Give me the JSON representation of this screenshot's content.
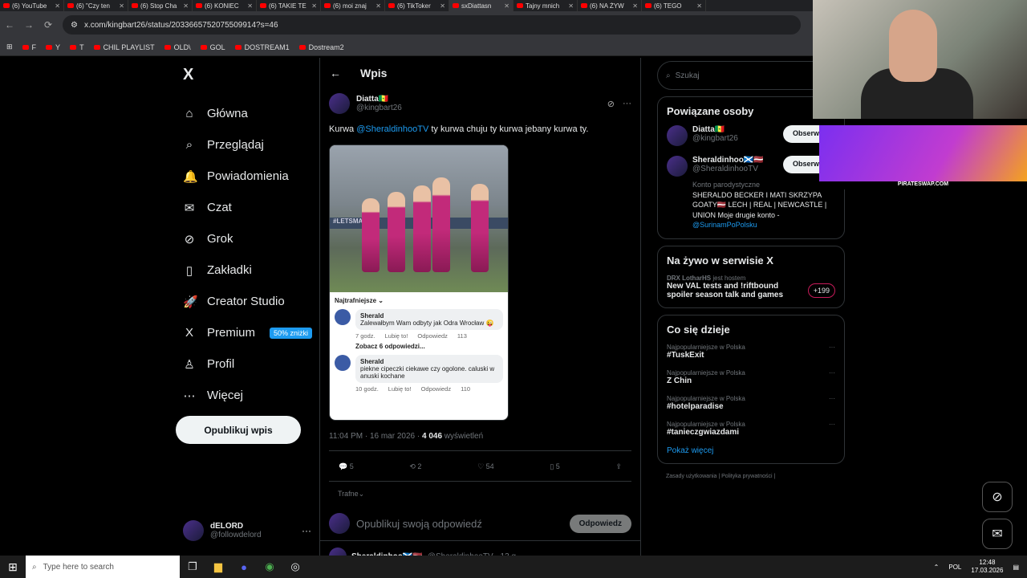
{
  "browser": {
    "tabs": [
      "(6) YouTube",
      "(6) \"Czy ten",
      "(6) Stop Cha",
      "(6) KONIEC",
      "(6) TAKIE TE",
      "(6) moi znaj",
      "(6) TikToker",
      "sxDiattasn",
      "Tajny mnich",
      "(6) NA ŻYW",
      "(6) TEGO"
    ],
    "url": "x.com/kingbart26/status/2033665752075509914?s=46",
    "bookmarks": [
      "F",
      "Y",
      "T",
      "CHIL PLAYLIST",
      "OLD\\",
      "GOL",
      "DOSTREAM1",
      "Dostream2"
    ]
  },
  "sidebar": {
    "logo": "X",
    "items": [
      {
        "label": "Główna",
        "icon": "⌂"
      },
      {
        "label": "Przeglądaj",
        "icon": "⌕"
      },
      {
        "label": "Powiadomienia",
        "icon": "🔔"
      },
      {
        "label": "Czat",
        "icon": "✉"
      },
      {
        "label": "Grok",
        "icon": "⊘"
      },
      {
        "label": "Zakładki",
        "icon": "▯"
      },
      {
        "label": "Creator Studio",
        "icon": "🚀"
      },
      {
        "label": "Premium",
        "icon": "X",
        "badge": "50% zniżki"
      },
      {
        "label": "Profil",
        "icon": "♙"
      },
      {
        "label": "Więcej",
        "icon": "⋯"
      }
    ],
    "post_button": "Opublikuj wpis",
    "account": {
      "name": "dELORD",
      "handle": "@followdelord",
      "more": "···"
    }
  },
  "main": {
    "back": "←",
    "title": "Wpis",
    "author": {
      "name": "Diatta🇸🇳",
      "handle": "@kingbart26"
    },
    "text_prefix": "Kurwa ",
    "mention": "@SheraldinhooTV",
    "text_suffix": " ty kurwa chuju ty kurwa jebany kurwa ty.",
    "media": {
      "banner": "#LETSMAKE",
      "sort": "Najtrafniejsze ⌄",
      "comments": [
        {
          "name": "Sherald",
          "text": "Zalewałbym Wam odbyty jak Odra Wrocław 😜",
          "time": "7 godz.",
          "like": "Lubię to!",
          "reply": "Odpowiedz",
          "count": "113"
        },
        {
          "name": "Sherald",
          "text": "piekne cipeczki ciekawe czy ogolone. caluski w anuski kochane",
          "time": "10 godz.",
          "like": "Lubię to!",
          "reply": "Odpowiedz",
          "count": "110"
        }
      ],
      "see_replies": "Zobacz 6 odpowiedzi..."
    },
    "meta_time": "11:04 PM · 16 mar 2026 · ",
    "views": "4 046",
    "views_label": " wyświetleń",
    "actions": {
      "replies": "5",
      "reposts": "2",
      "likes": "54",
      "bookmarks": "5"
    },
    "sort_label": "Trafne⌄",
    "reply_placeholder": "Opublikuj swoją odpowiedź",
    "reply_button": "Odpowiedz",
    "next_reply": {
      "name": "Sheraldinhoo🏴󠁧󠁢󠁳󠁣󠁴󠁿🇱🇻",
      "handle": "@SheraldinhooTV · 13 g."
    }
  },
  "right": {
    "search_placeholder": "Szukaj",
    "related_title": "Powiązane osoby",
    "people": [
      {
        "name": "Diatta🇸🇳",
        "handle": "@kingbart26",
        "follow": "Obserwuj"
      },
      {
        "name": "Sheraldinhoo🏴󠁧󠁢󠁳󠁣󠁴󠁿🇱🇻",
        "handle": "@SheraldinhooTV",
        "follow": "Obserwuj",
        "tag": "Konto parodystyczne",
        "bio": "SHERALDO BECKER I MATI SKRZYPA GOATY🇱🇻 LECH | REAL | NEWCASTLE | UNION Moje drugie konto -",
        "bio_link": "@SurinamPoPolsku"
      }
    ],
    "live_title": "Na żywo w serwisie X",
    "live_host": "DRX LotharHS",
    "live_host_suffix": "jest hostem",
    "live_text": "New VAL tests and !riftbound spoiler season talk and games",
    "live_count": "+199",
    "trends_title": "Co się dzieje",
    "trends": [
      {
        "cat": "Najpopularniejsze w Polska",
        "name": "#TuskExit"
      },
      {
        "cat": "Najpopularniejsze w Polska",
        "name": "Z Chin"
      },
      {
        "cat": "Najpopularniejsze w Polska",
        "name": "#hotelparadise"
      },
      {
        "cat": "Najpopularniejsze w Polska",
        "name": "#tanieczgwiazdami"
      }
    ],
    "show_more": "Pokaż więcej",
    "footer": "Zasady użytkowania | Polityka prywatności |"
  },
  "overlay": {
    "promo": "PIRATESWAP.COM"
  },
  "taskbar": {
    "search": "Type here to search",
    "lang": "POL",
    "time": "12:48",
    "date": "17.03.2026"
  }
}
